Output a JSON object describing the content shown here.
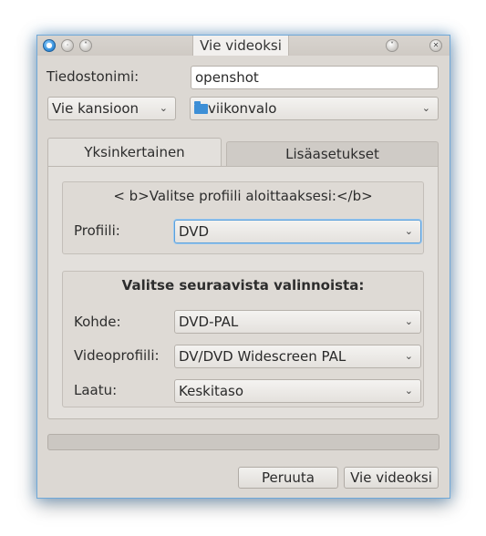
{
  "window": {
    "title": "Vie videoksi"
  },
  "form": {
    "filename_label": "Tiedostonimi:",
    "filename_value": "openshot",
    "export_folder_label": "Vie kansioon",
    "folder_value": "viikonvalo"
  },
  "tabs": [
    {
      "label": "Yksinkertainen"
    },
    {
      "label": "Lisäasetukset"
    }
  ],
  "profile_group": {
    "prompt": "< b>Valitse profiili aloittaaksesi:</b>",
    "profile_label": "Profiili:",
    "profile_value": "DVD"
  },
  "options_group": {
    "heading": "Valitse seuraavista valinnoista:",
    "target_label": "Kohde:",
    "target_value": "DVD-PAL",
    "video_profile_label": "Videoprofiili:",
    "video_profile_value": "DV/DVD Widescreen PAL",
    "quality_label": "Laatu:",
    "quality_value": "Keskitaso"
  },
  "progress": {
    "value": 0
  },
  "buttons": {
    "cancel": "Peruuta",
    "export": "Vie videoksi"
  },
  "colors": {
    "window_bg": "#dcd8d3",
    "focus_border": "#5aa0dc",
    "window_glow": "#6fa8d8",
    "folder_icon": "#3d8fd6"
  }
}
